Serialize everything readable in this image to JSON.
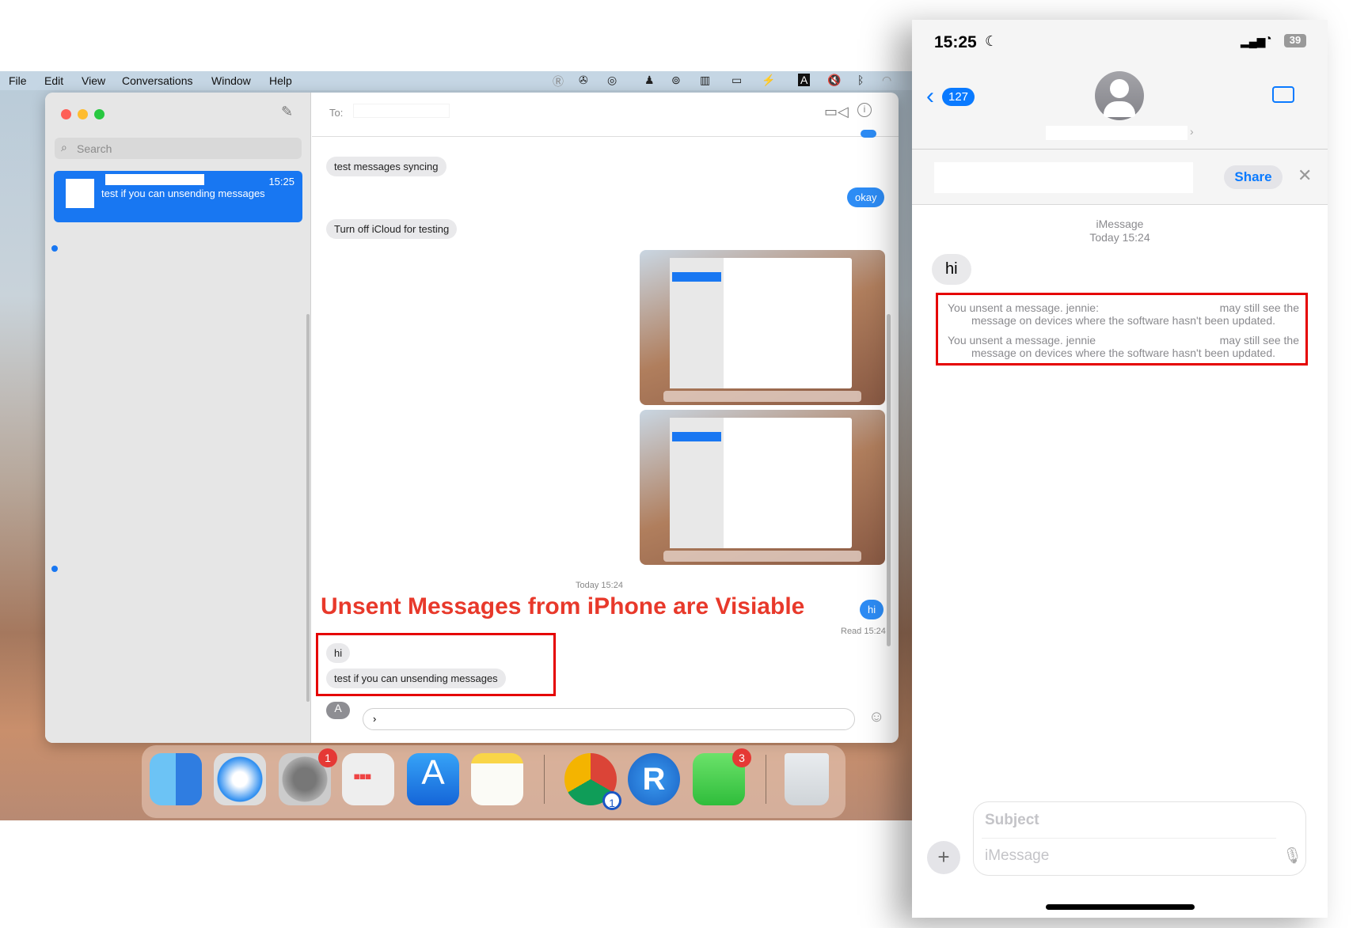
{
  "menubar": {
    "items": [
      "File",
      "Edit",
      "View",
      "Conversations",
      "Window",
      "Help"
    ]
  },
  "mac": {
    "search_placeholder": "Search",
    "conversation": {
      "time": "15:25",
      "preview": "test if you can unsending messages"
    },
    "header": {
      "to_label": "To:"
    },
    "messages": [
      {
        "text": "test messages syncing",
        "dir": "in"
      },
      {
        "text": "okay",
        "dir": "out"
      },
      {
        "text": "Turn off iCloud for testing",
        "dir": "in"
      },
      {
        "text": "hi",
        "dir": "out"
      },
      {
        "text": "hi",
        "dir": "in"
      },
      {
        "text": "test if you can unsending messages",
        "dir": "in"
      }
    ],
    "timestamp": "Today 15:24",
    "read_receipt": "Read 15:24",
    "input_value": "›"
  },
  "annotation": {
    "text": "Unsent Messages from iPhone are Visiable",
    "color": "#e8392b",
    "box_color": "#e50000"
  },
  "dock": {
    "items": [
      "Finder",
      "Safari",
      "System Preferences",
      "Launchpad",
      "App Store",
      "Notes",
      "Chrome",
      "RealVNC",
      "Messages",
      "Trash"
    ],
    "badges": {
      "system_preferences": "1",
      "chrome": "1",
      "messages": "3"
    }
  },
  "iphone": {
    "time": "15:25",
    "battery": "39",
    "back_badge": "127",
    "share_label": "Share",
    "service": "iMessage",
    "timestamp": "Today 15:24",
    "message": "hi",
    "unsent": [
      {
        "line1a": "You unsent a message. jennie:",
        "line1b": "may still see the",
        "line2": "message on devices where the software hasn't been updated."
      },
      {
        "line1a": "You unsent a message. jennie",
        "line1b": "may still see the",
        "line2": "message on devices where the software hasn't been updated."
      }
    ],
    "subject_placeholder": "Subject",
    "message_placeholder": "iMessage"
  },
  "colors": {
    "accent": "#1877f2",
    "ios_blue": "#0a7aff"
  }
}
